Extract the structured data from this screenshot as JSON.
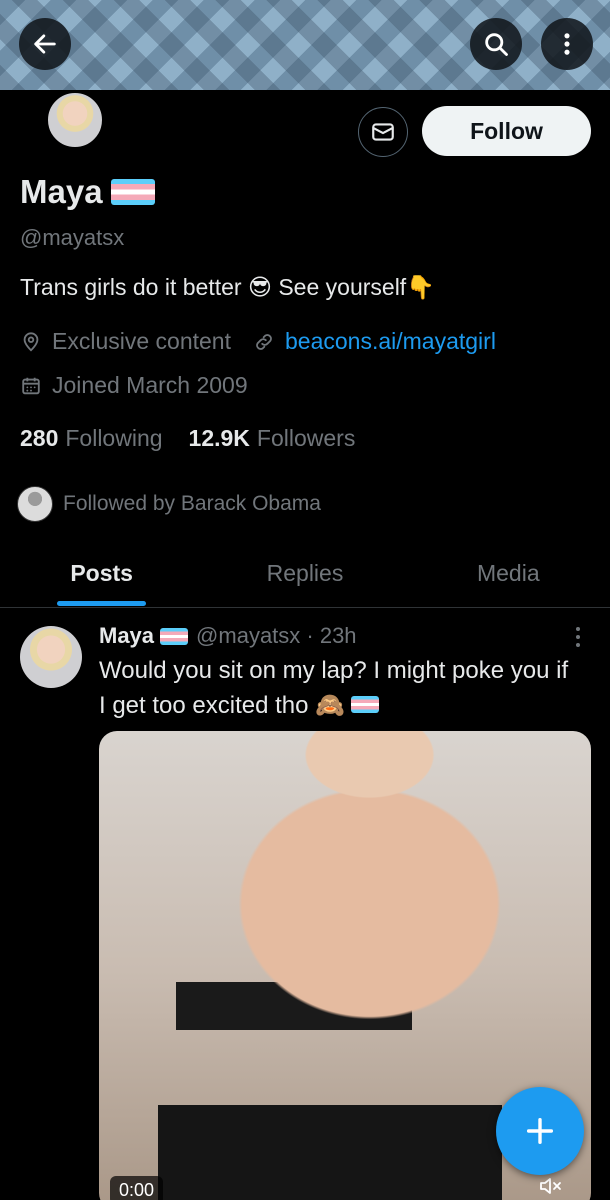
{
  "profile": {
    "display_name": "Maya",
    "handle": "@mayatsx",
    "bio": "Trans girls do it better",
    "bio_emoji_1": "😎",
    "bio_suffix": "See yourself",
    "bio_emoji_2": "👇",
    "location": "Exclusive content",
    "website": "beacons.ai/mayatgirl",
    "joined": "Joined March 2009",
    "following_count": "280",
    "following_label": "Following",
    "followers_count": "12.9K",
    "followers_label": "Followers",
    "followed_by": "Followed by Barack Obama"
  },
  "actions": {
    "follow_label": "Follow"
  },
  "tabs": [
    {
      "label": "Posts",
      "active": true
    },
    {
      "label": "Replies",
      "active": false
    },
    {
      "label": "Media",
      "active": false
    }
  ],
  "post": {
    "name": "Maya",
    "meta": "@mayatsx · 23h",
    "text": "Would you sit on my lap? I might poke you if I get too excited tho",
    "text_emoji": "🙈",
    "video_time": "0:00"
  },
  "colors": {
    "accent": "#1d9bf0",
    "background": "#000000",
    "text_primary": "#e7e9ea",
    "text_secondary": "#71767b"
  },
  "icons": {
    "back": "arrow-left-icon",
    "search": "search-icon",
    "more": "more-vertical-icon",
    "message": "envelope-icon",
    "location": "location-pin-icon",
    "link": "link-icon",
    "calendar": "calendar-icon",
    "mute": "speaker-muted-icon",
    "compose": "plus-icon"
  }
}
